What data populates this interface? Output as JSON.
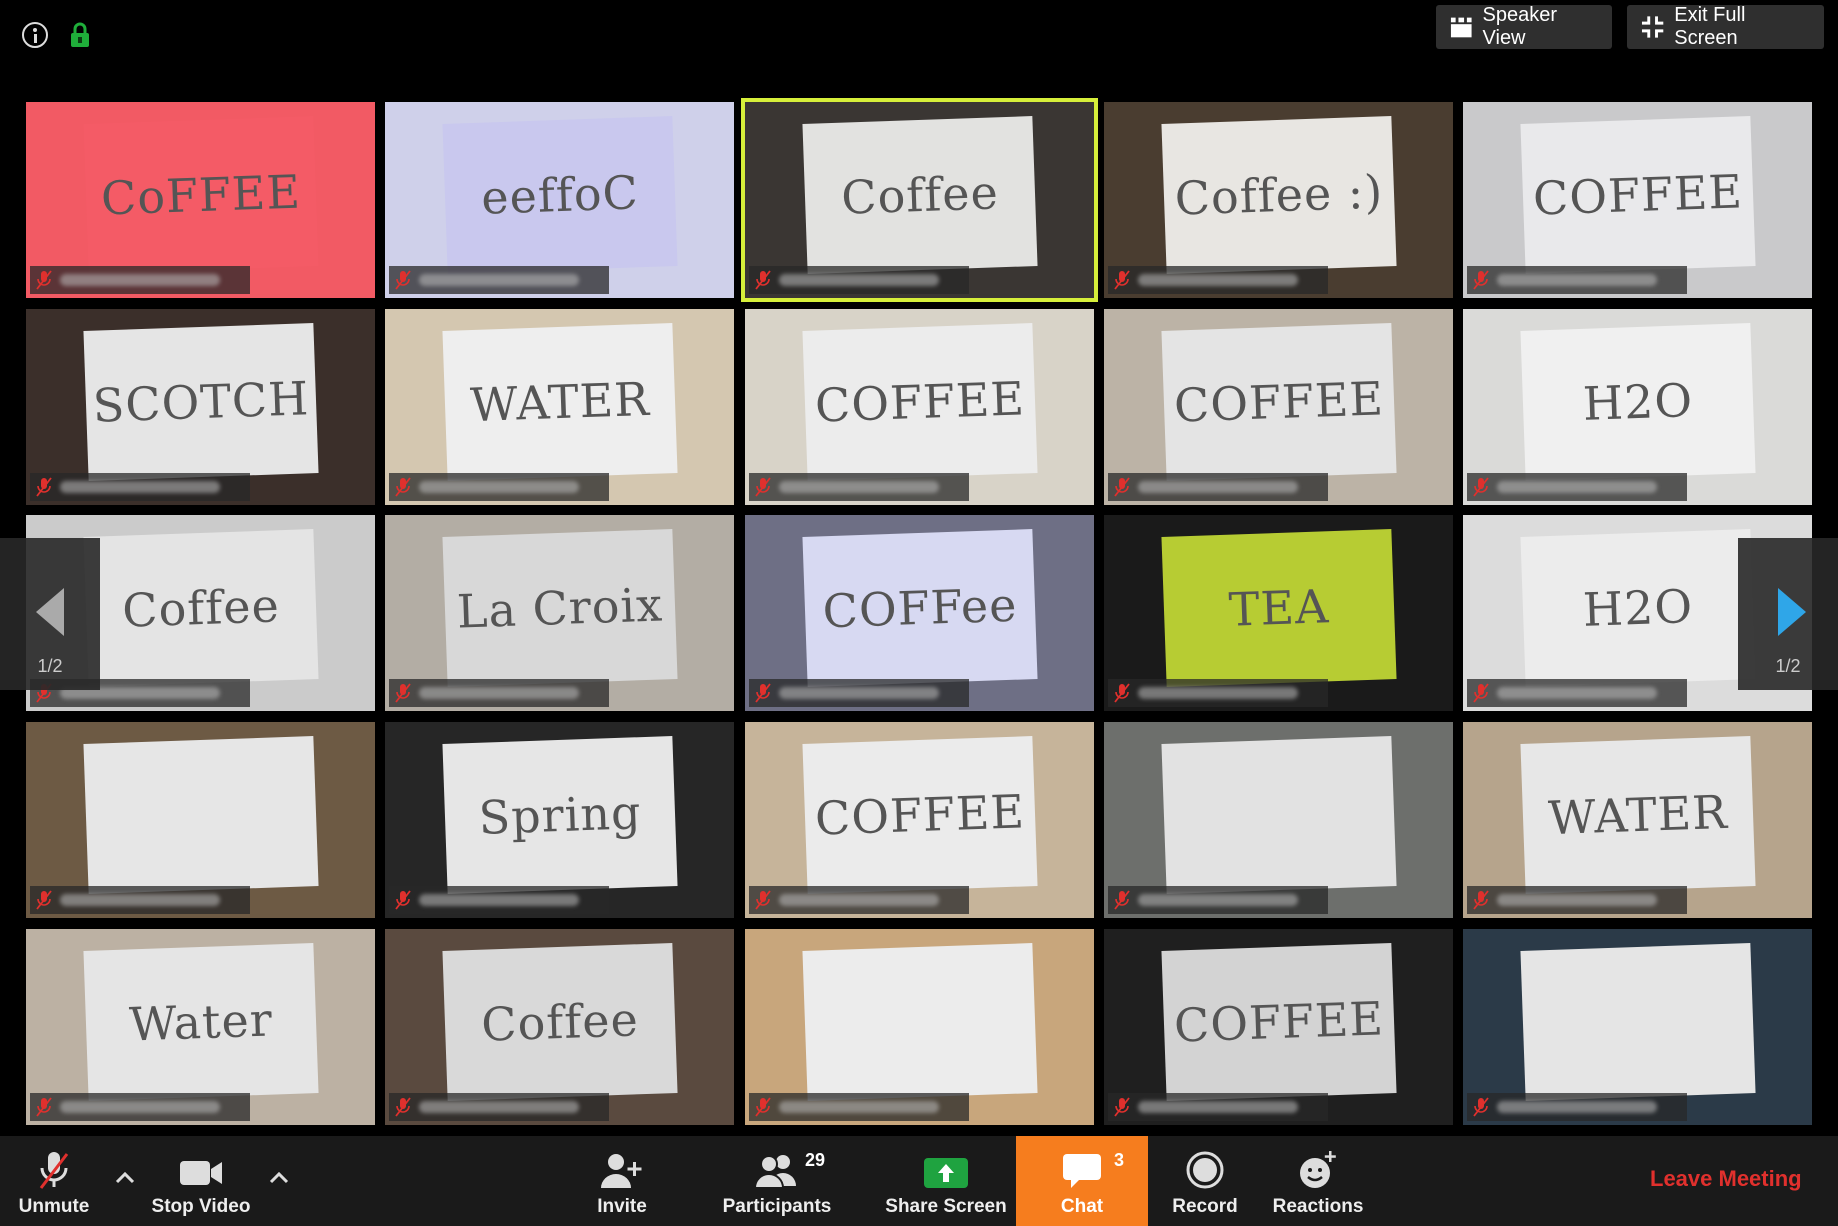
{
  "top_bar": {
    "speaker_view_label": "Speaker View",
    "exit_full_screen_label": "Exit Full Screen"
  },
  "tiles": [
    {
      "sign": "CoFFEE",
      "bg": "#f25a64",
      "paper": "#f45b66"
    },
    {
      "sign": "eeffoC",
      "bg": "#cfd0ea",
      "paper": "#c9c8ee"
    },
    {
      "sign": "Coffee",
      "bg": "#3a3633",
      "paper": "#e2e2e0",
      "active": true
    },
    {
      "sign": "Coffee :)",
      "bg": "#4a3d30",
      "paper": "#e8e6e2"
    },
    {
      "sign": "COFFEE",
      "bg": "#c9c9cb",
      "paper": "#e9e9eb"
    },
    {
      "sign": "SCOTCH",
      "bg": "#3b2f2a",
      "paper": "#e5e5e5"
    },
    {
      "sign": "WATER",
      "bg": "#d4c7b0",
      "paper": "#eeeeee"
    },
    {
      "sign": "COFFEE",
      "bg": "#d8d3c8",
      "paper": "#ececec"
    },
    {
      "sign": "COFFEE",
      "bg": "#bcb3a6",
      "paper": "#e4e4e4"
    },
    {
      "sign": "H2O",
      "bg": "#dadad8",
      "paper": "#f0f0f0"
    },
    {
      "sign": "Coffee",
      "bg": "#cbcbcb",
      "paper": "#e4e4e4"
    },
    {
      "sign": "La Croix",
      "bg": "#b3ada4",
      "paper": "#d8d8d8"
    },
    {
      "sign": "COFFee",
      "bg": "#6e6f85",
      "paper": "#d7d9f2"
    },
    {
      "sign": "TEA",
      "bg": "#1a1a1a",
      "paper": "#b7cc33"
    },
    {
      "sign": "H2O",
      "bg": "#dcdcdc",
      "paper": "#ececec"
    },
    {
      "sign": "",
      "bg": "#6d5a44",
      "paper": "#e6e6e6"
    },
    {
      "sign": "Spring",
      "bg": "#262626",
      "paper": "#e6e6e6"
    },
    {
      "sign": "COFFEE",
      "bg": "#c6b49a",
      "paper": "#ebebeb"
    },
    {
      "sign": "",
      "bg": "#6d6f6c",
      "paper": "#e2e2e2"
    },
    {
      "sign": "WATER",
      "bg": "#b6a48c",
      "paper": "#e7e7e7"
    },
    {
      "sign": "Water",
      "bg": "#bcb1a3",
      "paper": "#e5e5e5"
    },
    {
      "sign": "Coffee",
      "bg": "#5a4a3f",
      "paper": "#d9d9d9"
    },
    {
      "sign": "",
      "bg": "#c8a67c",
      "paper": "#ececec"
    },
    {
      "sign": "COFFEE",
      "bg": "#1f1f1f",
      "paper": "#d3d3d3"
    },
    {
      "sign": "",
      "bg": "#2b3a48",
      "paper": "#e5e5e5"
    }
  ],
  "pager": {
    "left_page": "1/2",
    "right_page": "1/2"
  },
  "toolbar": {
    "unmute_label": "Unmute",
    "stop_video_label": "Stop Video",
    "invite_label": "Invite",
    "participants_label": "Participants",
    "participants_count": "29",
    "share_screen_label": "Share Screen",
    "chat_label": "Chat",
    "chat_count": "3",
    "record_label": "Record",
    "reactions_label": "Reactions",
    "leave_label": "Leave Meeting"
  },
  "colors": {
    "active_speaker": "#d6ef3a",
    "chat_active": "#f67d1e",
    "leave": "#e0302d",
    "share_green": "#1fa340",
    "lock_green": "#1fae3a",
    "next_arrow": "#2fa6e8"
  }
}
